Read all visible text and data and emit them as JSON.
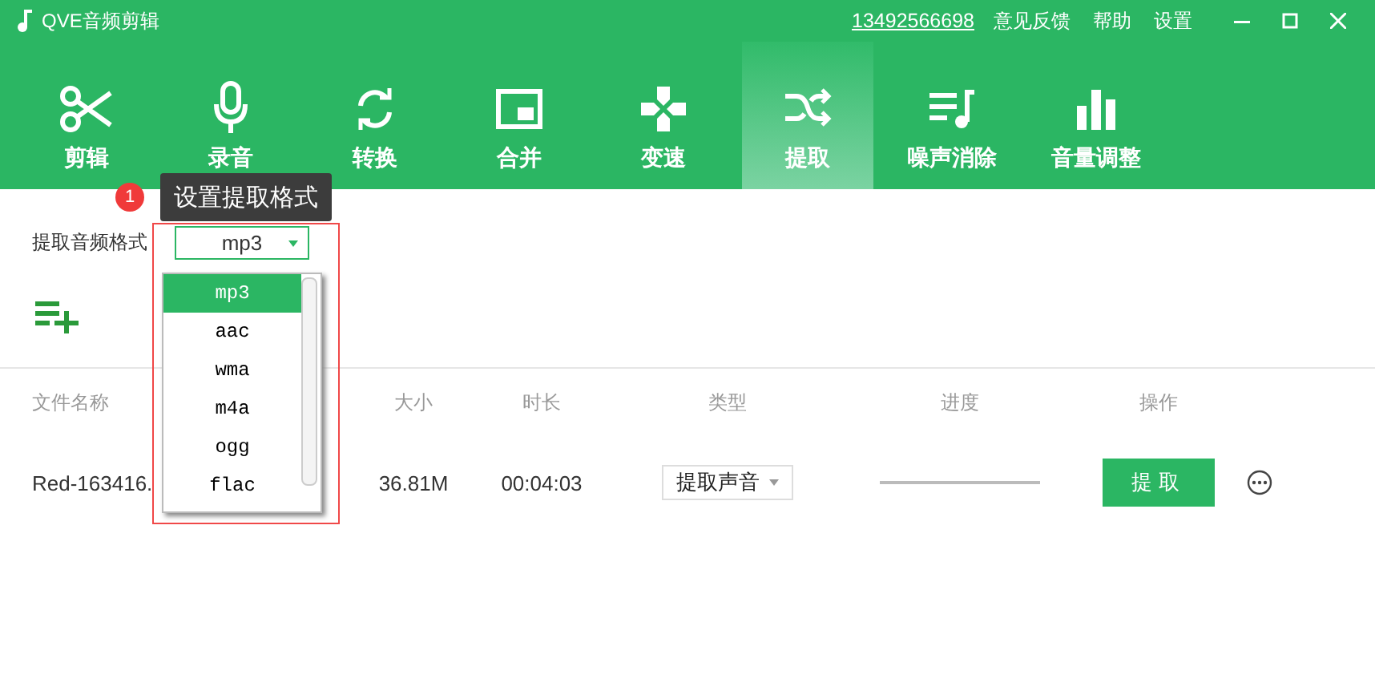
{
  "window": {
    "title": "QVE音频剪辑"
  },
  "account": "13492566698",
  "links": [
    "意见反馈",
    "帮助",
    "设置"
  ],
  "toolbar": [
    {
      "label": "剪辑",
      "selected": false
    },
    {
      "label": "录音",
      "selected": false
    },
    {
      "label": "转换",
      "selected": false
    },
    {
      "label": "合并",
      "selected": false
    },
    {
      "label": "变速",
      "selected": false
    },
    {
      "label": "提取",
      "selected": true
    },
    {
      "label": "噪声消除",
      "selected": false
    },
    {
      "label": "音量调整",
      "selected": false
    }
  ],
  "tooltip": {
    "step": "1",
    "text": "设置提取格式"
  },
  "format": {
    "label": "提取音频格式",
    "value": "mp3",
    "options": [
      {
        "label": "mp3",
        "selected": true
      },
      {
        "label": "aac",
        "selected": false
      },
      {
        "label": "wma",
        "selected": false
      },
      {
        "label": "m4a",
        "selected": false
      },
      {
        "label": "ogg",
        "selected": false
      },
      {
        "label": "flac",
        "selected": false
      }
    ]
  },
  "table": {
    "columns": [
      "文件名称",
      "大小",
      "时长",
      "类型",
      "进度",
      "操作"
    ],
    "rows": [
      {
        "name": "Red-163416.",
        "size": "36.81M",
        "duration": "00:04:03",
        "type": "提取声音",
        "level": 0,
        "action": "提取"
      }
    ]
  }
}
